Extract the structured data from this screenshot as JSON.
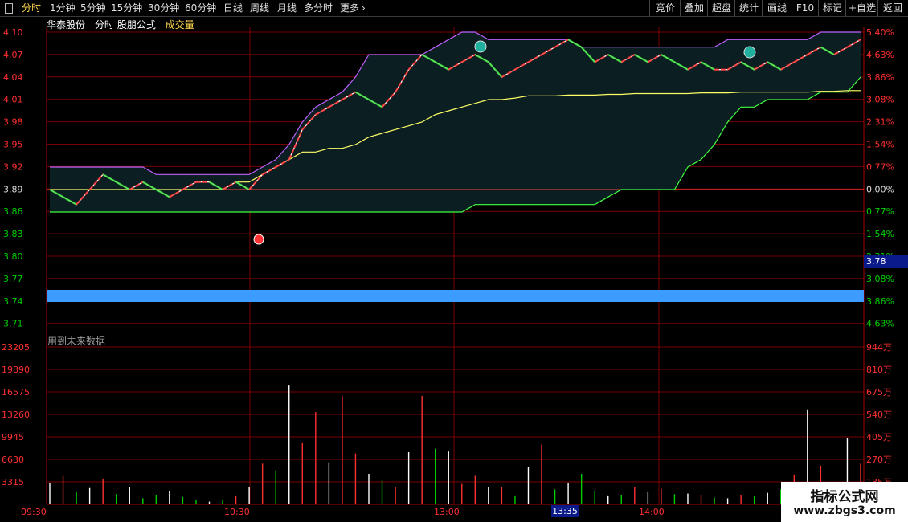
{
  "toolbar": {
    "left_tabs": [
      "分时",
      "1分钟",
      "5分钟",
      "15分钟",
      "30分钟",
      "60分钟",
      "日线",
      "周线",
      "月线",
      "多分时",
      "更多"
    ],
    "more_arrow": "›",
    "right_buttons": [
      "竞价",
      "叠加",
      "超盘",
      "统计",
      "画线",
      "F10",
      "标记",
      "+自选",
      "返回"
    ]
  },
  "header": {
    "stock": "华泰股份",
    "period": "分时",
    "formula": "股朋公式",
    "indicator": "成交量"
  },
  "price_axis": {
    "labels": [
      "4.10",
      "4.07",
      "4.04",
      "4.01",
      "3.98",
      "3.95",
      "3.92",
      "3.89",
      "3.86",
      "3.83",
      "3.80",
      "3.77",
      "3.74",
      "3.71"
    ]
  },
  "pct_axis": {
    "labels": [
      "5.40%",
      "4.63%",
      "3.86%",
      "3.08%",
      "2.31%",
      "1.54%",
      "0.77%",
      "0.00%",
      "0.77%",
      "1.54%",
      "2.31%",
      "3.08%",
      "3.86%",
      "4.63%"
    ]
  },
  "vol_axis": {
    "left": [
      "23205",
      "19890",
      "16575",
      "13260",
      "9945",
      "6630",
      "3315"
    ],
    "right": [
      "944万",
      "810万",
      "675万",
      "540万",
      "405万",
      "270万",
      "135万"
    ]
  },
  "time_axis": {
    "labels": [
      "09:30",
      "10:30",
      "13:00",
      "14:00"
    ],
    "cursor": "13:35"
  },
  "cursor_price": "3.78",
  "note_text": "用到未来数据",
  "watermark": {
    "line1": "指标公式网",
    "line2": "www.zbgs3.com"
  },
  "colors": {
    "grid": "#7a0000",
    "up": "#ff3030",
    "down": "#00d000",
    "price": "#ffffff",
    "avg": "#ffff66",
    "band_upper": "#c060ff",
    "band_lower": "#40ff40"
  },
  "chart_data": {
    "type": "line",
    "prev_close": 3.89,
    "price_range": [
      3.71,
      4.1
    ],
    "volume_range": [
      0,
      23205
    ],
    "price_series": [
      3.89,
      3.88,
      3.87,
      3.89,
      3.91,
      3.9,
      3.89,
      3.9,
      3.89,
      3.88,
      3.89,
      3.9,
      3.9,
      3.89,
      3.9,
      3.89,
      3.91,
      3.92,
      3.93,
      3.97,
      3.99,
      4.0,
      4.01,
      4.02,
      4.01,
      4.0,
      4.02,
      4.05,
      4.07,
      4.06,
      4.05,
      4.06,
      4.07,
      4.06,
      4.04,
      4.05,
      4.06,
      4.07,
      4.08,
      4.09,
      4.08,
      4.06,
      4.07,
      4.06,
      4.07,
      4.06,
      4.07,
      4.06,
      4.05,
      4.06,
      4.05,
      4.05,
      4.06,
      4.05,
      4.06,
      4.05,
      4.06,
      4.07,
      4.08,
      4.07,
      4.08,
      4.09
    ],
    "avg_series": [
      3.89,
      3.89,
      3.89,
      3.89,
      3.89,
      3.89,
      3.89,
      3.89,
      3.89,
      3.89,
      3.89,
      3.89,
      3.89,
      3.89,
      3.9,
      3.9,
      3.91,
      3.92,
      3.93,
      3.94,
      3.94,
      3.945,
      3.945,
      3.95,
      3.96,
      3.965,
      3.97,
      3.975,
      3.98,
      3.99,
      3.995,
      4.0,
      4.005,
      4.01,
      4.01,
      4.012,
      4.015,
      4.015,
      4.015,
      4.016,
      4.016,
      4.016,
      4.017,
      4.017,
      4.018,
      4.018,
      4.018,
      4.018,
      4.018,
      4.019,
      4.019,
      4.019,
      4.02,
      4.02,
      4.02,
      4.02,
      4.02,
      4.02,
      4.021,
      4.021,
      4.022,
      4.022
    ],
    "upper_band": [
      3.92,
      3.92,
      3.92,
      3.92,
      3.92,
      3.92,
      3.92,
      3.92,
      3.91,
      3.91,
      3.91,
      3.91,
      3.91,
      3.91,
      3.91,
      3.91,
      3.92,
      3.93,
      3.95,
      3.98,
      4.0,
      4.01,
      4.02,
      4.04,
      4.07,
      4.07,
      4.07,
      4.07,
      4.07,
      4.08,
      4.09,
      4.1,
      4.1,
      4.09,
      4.09,
      4.09,
      4.09,
      4.09,
      4.09,
      4.09,
      4.08,
      4.08,
      4.08,
      4.08,
      4.08,
      4.08,
      4.08,
      4.08,
      4.08,
      4.08,
      4.08,
      4.09,
      4.09,
      4.09,
      4.09,
      4.09,
      4.09,
      4.09,
      4.1,
      4.1,
      4.1,
      4.1
    ],
    "lower_band": [
      3.86,
      3.86,
      3.86,
      3.86,
      3.86,
      3.86,
      3.86,
      3.86,
      3.86,
      3.86,
      3.86,
      3.86,
      3.86,
      3.86,
      3.86,
      3.86,
      3.86,
      3.86,
      3.86,
      3.86,
      3.86,
      3.86,
      3.86,
      3.86,
      3.86,
      3.86,
      3.86,
      3.86,
      3.86,
      3.86,
      3.86,
      3.86,
      3.87,
      3.87,
      3.87,
      3.87,
      3.87,
      3.87,
      3.87,
      3.87,
      3.87,
      3.87,
      3.88,
      3.89,
      3.89,
      3.89,
      3.89,
      3.89,
      3.92,
      3.93,
      3.95,
      3.98,
      4.0,
      4.0,
      4.01,
      4.01,
      4.01,
      4.01,
      4.02,
      4.02,
      4.02,
      4.04
    ],
    "volumes": [
      3200,
      4200,
      1800,
      2400,
      3800,
      1500,
      2600,
      900,
      1300,
      2000,
      1100,
      600,
      400,
      700,
      1200,
      2600,
      6000,
      5000,
      17500,
      9000,
      13600,
      6200,
      16000,
      7500,
      4500,
      3500,
      2600,
      7700,
      16000,
      8200,
      7800,
      3000,
      4200,
      2500,
      2600,
      1200,
      5500,
      8800,
      2200,
      3200,
      4500,
      1900,
      1200,
      1300,
      2600,
      1800,
      2300,
      1500,
      1600,
      1300,
      1000,
      900,
      1400,
      1200,
      1700,
      2200,
      4400,
      14000,
      5700,
      2800,
      9700,
      6000
    ],
    "volume_up": [
      1,
      1,
      0,
      1,
      1,
      0,
      1,
      0,
      0,
      1,
      0,
      0,
      0,
      0,
      1,
      1,
      1,
      0,
      1,
      1,
      1,
      0,
      1,
      1,
      0,
      0,
      1,
      1,
      1,
      0,
      0,
      1,
      1,
      0,
      1,
      0,
      1,
      1,
      0,
      1,
      0,
      0,
      1,
      0,
      1,
      0,
      1,
      0,
      0,
      1,
      0,
      0,
      1,
      0,
      1,
      0,
      1,
      1,
      1,
      0,
      1,
      1
    ]
  }
}
